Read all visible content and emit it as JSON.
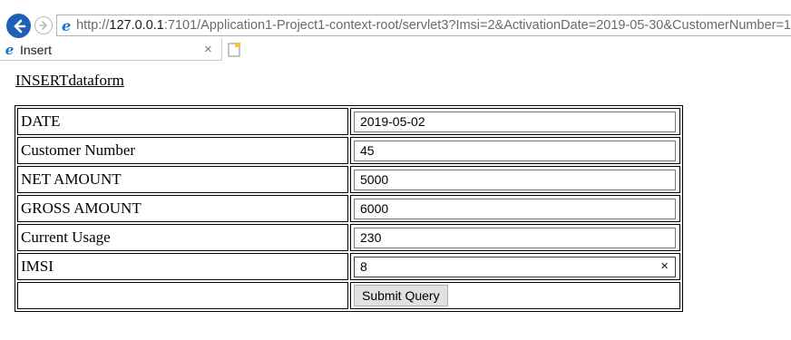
{
  "browser": {
    "url_host": "127.0.0.1",
    "url_rest": ":7101/Application1-Project1-context-root/servlet3?Imsi=2&ActivationDate=2019-05-30&CustomerNumber=1",
    "url_prefix": "http://",
    "tab_title": "Insert",
    "tab_close": "×"
  },
  "page": {
    "heading": "INSERTdataform"
  },
  "form": {
    "rows": [
      {
        "label": "DATE",
        "value": "2019-05-02"
      },
      {
        "label": "Customer Number",
        "value": "45"
      },
      {
        "label": "NET AMOUNT",
        "value": "5000"
      },
      {
        "label": "GROSS AMOUNT",
        "value": "6000"
      },
      {
        "label": "Current Usage",
        "value": "230"
      },
      {
        "label": "IMSI",
        "value": "8"
      }
    ],
    "clear_glyph": "×",
    "submit_label": "Submit Query"
  }
}
